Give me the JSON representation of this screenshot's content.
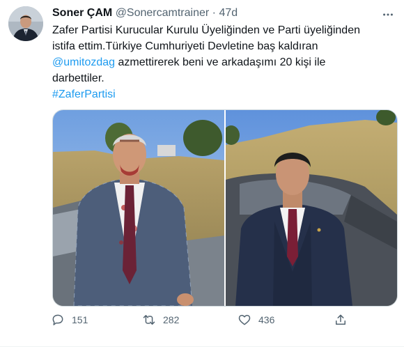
{
  "tweet": {
    "author_name": "Soner ÇAM",
    "author_handle": "@Sonercamtrainer",
    "separator": "·",
    "time": "47d",
    "text_line1": "Zafer Partisi Kurucular Kurulu Üyeliğinden ve Parti üyeliğinden",
    "text_line2": "istifa ettim.Türkiye Cumhuriyeti Devletine baş kaldıran",
    "mention": "@umitozdag",
    "text_line3_rest": " azmettirerek beni ve arkadaşımı 20 kişi ile",
    "text_line4": "darbettiler.",
    "hashtag": "#ZaferPartisi"
  },
  "actions": {
    "reply_count": "151",
    "retweet_count": "282",
    "like_count": "436"
  },
  "icons": {
    "more": "more-options-icon",
    "reply": "reply-icon",
    "retweet": "retweet-icon",
    "like": "heart-icon",
    "share": "share-icon"
  },
  "colors": {
    "link": "#1d9bf0",
    "secondary_text": "#536471",
    "primary_text": "#0f1419"
  }
}
